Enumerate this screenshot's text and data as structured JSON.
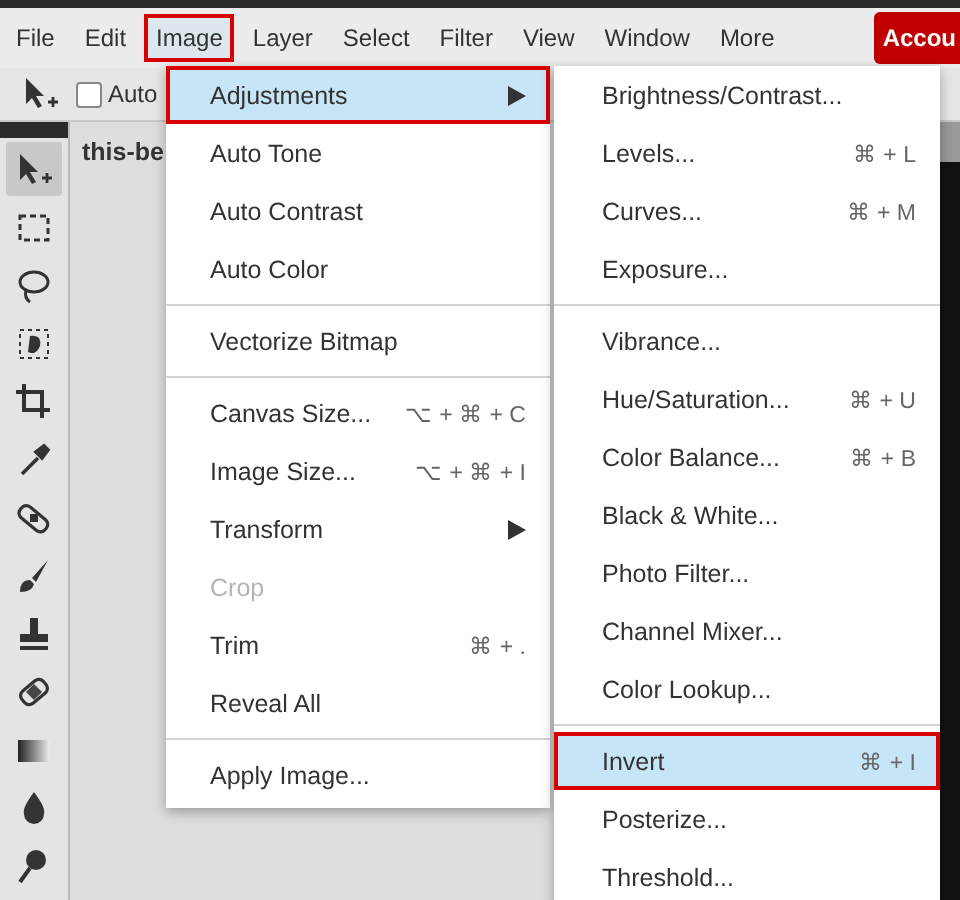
{
  "menubar": {
    "items": [
      {
        "label": "File",
        "selected": false
      },
      {
        "label": "Edit",
        "selected": false
      },
      {
        "label": "Image",
        "selected": true
      },
      {
        "label": "Layer",
        "selected": false
      },
      {
        "label": "Select",
        "selected": false
      },
      {
        "label": "Filter",
        "selected": false
      },
      {
        "label": "View",
        "selected": false
      },
      {
        "label": "Window",
        "selected": false
      },
      {
        "label": "More",
        "selected": false
      }
    ],
    "account_button": "Accou"
  },
  "options_bar": {
    "auto_select": {
      "label": "Auto",
      "checked": false
    }
  },
  "toolbar": {
    "tools": [
      {
        "kind": "move",
        "selected": true
      },
      {
        "kind": "marquee",
        "selected": false
      },
      {
        "kind": "lasso",
        "selected": false
      },
      {
        "kind": "quickselect",
        "selected": false
      },
      {
        "kind": "crop",
        "selected": false
      },
      {
        "kind": "eyedropper",
        "selected": false
      },
      {
        "kind": "healing",
        "selected": false
      },
      {
        "kind": "brush",
        "selected": false
      },
      {
        "kind": "stamp",
        "selected": false
      },
      {
        "kind": "eraser",
        "selected": false
      },
      {
        "kind": "gradient",
        "selected": false
      },
      {
        "kind": "blur",
        "selected": false
      },
      {
        "kind": "dodge",
        "selected": false
      }
    ]
  },
  "document_tab": "this-be",
  "image_menu": {
    "items": [
      {
        "kind": "item",
        "label": "Adjustments",
        "submenu": true,
        "selected": true
      },
      {
        "kind": "item",
        "label": "Auto Tone",
        "selected": false
      },
      {
        "kind": "item",
        "label": "Auto Contrast",
        "selected": false
      },
      {
        "kind": "item",
        "label": "Auto Color",
        "selected": false
      },
      {
        "kind": "separator"
      },
      {
        "kind": "item",
        "label": "Vectorize Bitmap",
        "selected": false
      },
      {
        "kind": "separator"
      },
      {
        "kind": "item",
        "label": "Canvas Size...",
        "shortcut": "⌥ + ⌘ + C",
        "selected": false
      },
      {
        "kind": "item",
        "label": "Image Size...",
        "shortcut": "⌥ + ⌘ + I",
        "selected": false
      },
      {
        "kind": "item",
        "label": "Transform",
        "submenu": true,
        "selected": false
      },
      {
        "kind": "item",
        "label": "Crop",
        "disabled": true,
        "selected": false
      },
      {
        "kind": "item",
        "label": "Trim",
        "shortcut": "⌘ + .",
        "selected": false
      },
      {
        "kind": "item",
        "label": "Reveal All",
        "selected": false
      },
      {
        "kind": "separator"
      },
      {
        "kind": "item",
        "label": "Apply Image...",
        "selected": false
      }
    ]
  },
  "adjustments_menu": {
    "items": [
      {
        "kind": "item",
        "label": "Brightness/Contrast...",
        "selected": false
      },
      {
        "kind": "item",
        "label": "Levels...",
        "shortcut": "⌘ + L",
        "selected": false
      },
      {
        "kind": "item",
        "label": "Curves...",
        "shortcut": "⌘ + M",
        "selected": false
      },
      {
        "kind": "item",
        "label": "Exposure...",
        "selected": false
      },
      {
        "kind": "separator"
      },
      {
        "kind": "item",
        "label": "Vibrance...",
        "selected": false
      },
      {
        "kind": "item",
        "label": "Hue/Saturation...",
        "shortcut": "⌘ + U",
        "selected": false
      },
      {
        "kind": "item",
        "label": "Color Balance...",
        "shortcut": "⌘ + B",
        "selected": false
      },
      {
        "kind": "item",
        "label": "Black & White...",
        "selected": false
      },
      {
        "kind": "item",
        "label": "Photo Filter...",
        "selected": false
      },
      {
        "kind": "item",
        "label": "Channel Mixer...",
        "selected": false
      },
      {
        "kind": "item",
        "label": "Color Lookup...",
        "selected": false
      },
      {
        "kind": "separator"
      },
      {
        "kind": "item",
        "label": "Invert",
        "shortcut": "⌘ + I",
        "selected": true
      },
      {
        "kind": "item",
        "label": "Posterize...",
        "selected": false
      },
      {
        "kind": "item",
        "label": "Threshold...",
        "selected": false
      }
    ]
  }
}
